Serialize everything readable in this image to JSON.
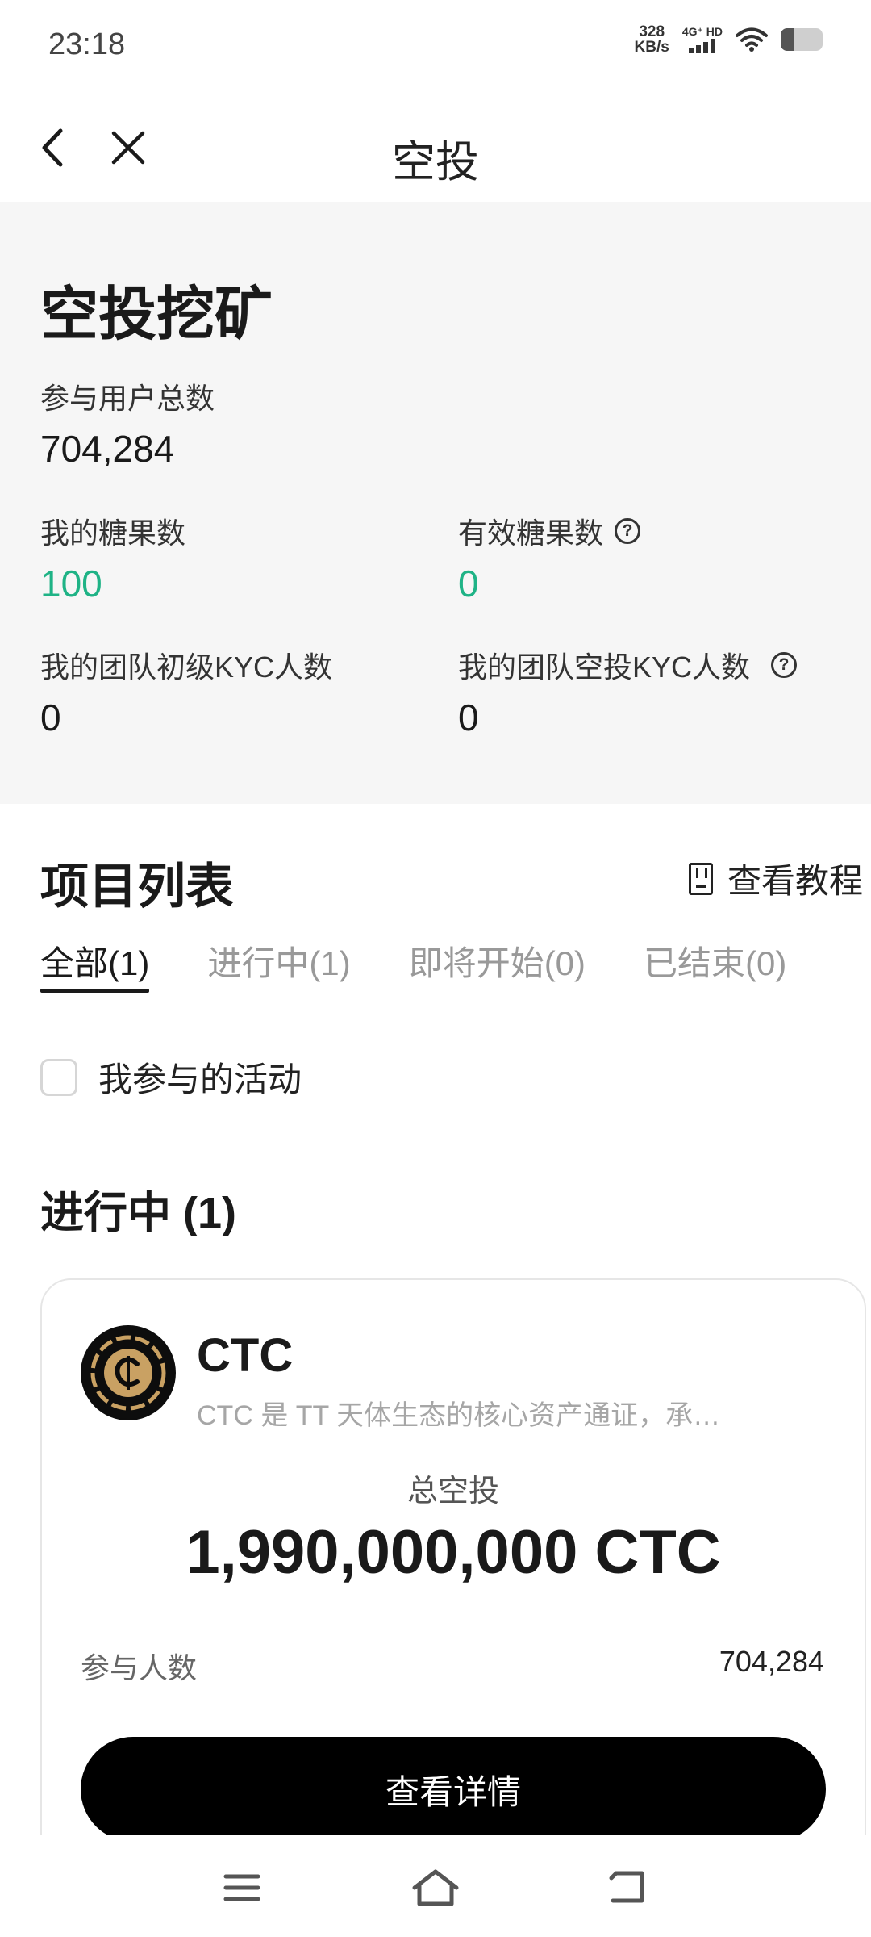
{
  "status_bar": {
    "time": "23:18",
    "net_speed_value": "328",
    "net_speed_unit": "KB/s",
    "signal_label": "4G⁺ HD",
    "battery_level_percent": 30,
    "icons": [
      "signal-icon",
      "wifi-icon",
      "battery-icon"
    ]
  },
  "nav": {
    "title": "空投",
    "back_icon": "chevron-left-icon",
    "close_icon": "close-icon"
  },
  "summary": {
    "title": "空投挖矿",
    "total_users_label": "参与用户总数",
    "total_users_value": "704,284",
    "my_candy_label": "我的糖果数",
    "my_candy_value": "100",
    "valid_candy_label": "有效糖果数",
    "valid_candy_value": "0",
    "team_kyc_label": "我的团队初级KYC人数",
    "team_kyc_value": "0",
    "team_airdrop_kyc_label": "我的团队空投KYC人数",
    "team_airdrop_kyc_value": "0",
    "help_glyph": "?",
    "accent_color": "#1fb386"
  },
  "projects": {
    "title": "项目列表",
    "tutorial_label": "查看教程",
    "tabs": [
      {
        "label": "全部(1)",
        "active": true
      },
      {
        "label": "进行中(1)",
        "active": false
      },
      {
        "label": "即将开始(0)",
        "active": false
      },
      {
        "label": "已结束(0)",
        "active": false
      }
    ],
    "filter_label": "我参与的活动",
    "filter_checked": false,
    "section_title": "进行中 (1)"
  },
  "card": {
    "coin_name": "CTC",
    "coin_desc": "CTC 是 TT 天体生态的核心资产通证，承…",
    "airdrop_label": "总空投",
    "airdrop_value": "1,990,000,000 CTC",
    "participants_label": "参与人数",
    "participants_value": "704,284",
    "button_label": "查看详情",
    "logo_colors": [
      "#0d0d0d",
      "#c9a163"
    ]
  },
  "bottom_nav": {
    "icons": [
      "menu-icon",
      "home-icon",
      "back-icon"
    ]
  }
}
